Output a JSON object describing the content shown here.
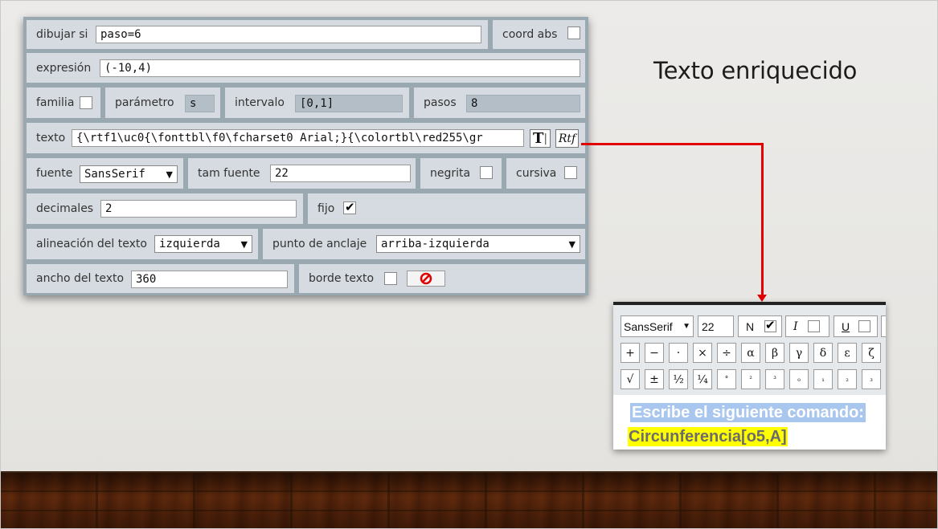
{
  "slide": {
    "heading": "Texto enriquecido"
  },
  "panel": {
    "condition": {
      "label": "dibujar si",
      "value": "paso=6"
    },
    "coord_abs": {
      "label": "coord abs",
      "checked": false
    },
    "expression": {
      "label": "expresión",
      "value": "(-10,4)"
    },
    "family": {
      "label": "familia",
      "checked": false
    },
    "parameter": {
      "label": "parámetro",
      "value": "s"
    },
    "interval": {
      "label": "intervalo",
      "value": "[0,1]"
    },
    "steps": {
      "label": "pasos",
      "value": "8"
    },
    "text": {
      "label": "texto",
      "value": "{\\rtf1\\uc0{\\fonttbl\\f0\\fcharset0 Arial;}{\\colortbl\\red255\\gr",
      "plain_button": "T",
      "rtf_button": "Rtf"
    },
    "font": {
      "label": "fuente",
      "value": "SansSerif"
    },
    "font_size": {
      "label": "tam fuente",
      "value": "22"
    },
    "bold": {
      "label": "negrita",
      "checked": false
    },
    "italic": {
      "label": "cursiva",
      "checked": false
    },
    "decimals": {
      "label": "decimales",
      "value": "2"
    },
    "fixed": {
      "label": "fijo",
      "checked": true
    },
    "text_align": {
      "label": "alineación del texto",
      "value": "izquierda"
    },
    "anchor": {
      "label": "punto de anclaje",
      "value": "arriba-izquierda"
    },
    "text_width": {
      "label": "ancho del texto",
      "value": "360"
    },
    "text_border": {
      "label": "borde texto",
      "checked": false
    }
  },
  "editor": {
    "font": "SansSerif",
    "size": "22",
    "bold_label": "N",
    "bold_checked": true,
    "italic_label": "I",
    "italic_checked": false,
    "underline_label": "U",
    "underline_checked": false,
    "symbols_row1": [
      "+",
      "−",
      "·",
      "×",
      "÷",
      "α",
      "β",
      "γ",
      "δ",
      "ε",
      "ζ"
    ],
    "symbols_row2": [
      "√",
      "±",
      "½",
      "¼",
      "°",
      "²",
      "³",
      "₀",
      "₁",
      "₂",
      "₃"
    ],
    "line1": "Escribe el siguiente comando:",
    "line2": "Circunferencia[o5,A]"
  },
  "colors": {
    "panel_border": "#9aa8b2",
    "cell_bg": "#d5dbe0",
    "readonly_field": "#b4bec6",
    "connector": "#e00000",
    "highlight_blue": "#a9c7ee",
    "highlight_yellow": "#ffff00"
  },
  "icons": {
    "no_border": "prohibited-icon",
    "dropdown": "chevron-down-icon",
    "checkmark": "check-icon"
  }
}
